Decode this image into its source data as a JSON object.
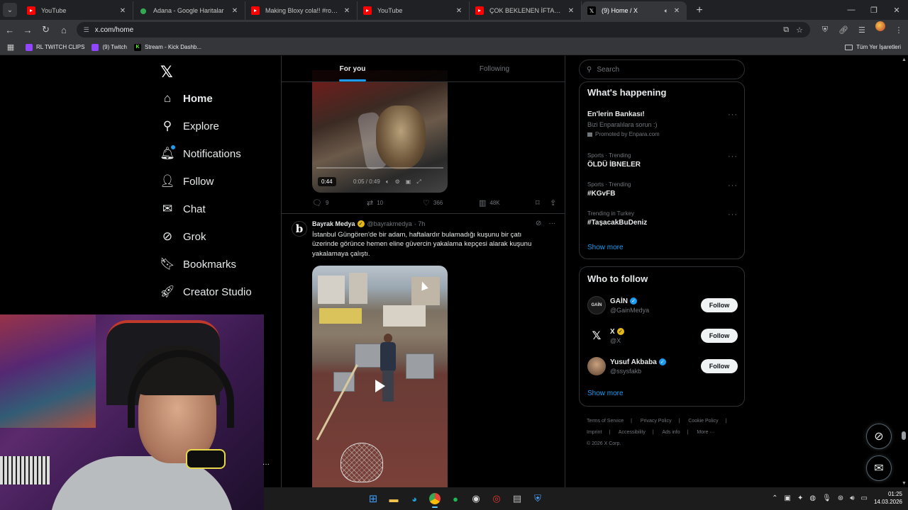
{
  "browser": {
    "tabs": [
      {
        "title": "YouTube",
        "icon": "youtube-icon",
        "active": false
      },
      {
        "title": "Adana - Google Haritalar",
        "icon": "maps-icon",
        "active": false
      },
      {
        "title": "Making Bloxy cola!! #roblox #p",
        "icon": "youtube-icon",
        "active": false
      },
      {
        "title": "YouTube",
        "icon": "youtube-icon",
        "active": false
      },
      {
        "title": "ÇOK BEKLENEN İFTAR! | Alperen",
        "icon": "youtube-icon",
        "active": false
      },
      {
        "title": "(9) Home / X",
        "icon": "x-icon",
        "active": true
      }
    ],
    "new_tab_label": "+",
    "url": "x.com/home",
    "bookmarks": [
      {
        "label": "RL TWITCH CLIPS",
        "icon": "twitch-icon"
      },
      {
        "label": "(9) Twitch",
        "icon": "twitch-icon"
      },
      {
        "label": "Stream - Kick Dashb...",
        "icon": "kick-icon"
      }
    ],
    "all_bookmarks_label": "Tüm Yer İşaretleri"
  },
  "nav": {
    "logo": "𝕏",
    "items": [
      {
        "label": "Home",
        "icon": "home-icon",
        "glyph": "⌂",
        "active": true
      },
      {
        "label": "Explore",
        "icon": "search-icon",
        "glyph": "⚲",
        "active": false
      },
      {
        "label": "Notifications",
        "icon": "bell-icon",
        "glyph": "🔔︎",
        "active": false,
        "badge": true
      },
      {
        "label": "Follow",
        "icon": "person-add-icon",
        "glyph": "👤︎",
        "active": false
      },
      {
        "label": "Chat",
        "icon": "mail-icon",
        "glyph": "✉",
        "active": false
      },
      {
        "label": "Grok",
        "icon": "grok-icon",
        "glyph": "⊘",
        "active": false
      },
      {
        "label": "Bookmarks",
        "icon": "bookmark-icon",
        "glyph": "🔖︎",
        "active": false
      },
      {
        "label": "Creator Studio",
        "icon": "rocket-icon",
        "glyph": "🚀︎",
        "active": false
      }
    ]
  },
  "feed": {
    "tabs": [
      {
        "label": "For you",
        "active": true
      },
      {
        "label": "Following",
        "active": false
      }
    ],
    "prev_post": {
      "video_duration": "0:44",
      "video_ctrls": "0:05 / 0:49",
      "replies": "9",
      "reposts": "10",
      "likes": "366",
      "views": "48K"
    },
    "post": {
      "author": "Bayrak Medya",
      "handle": "@bayrakmedya",
      "time": "· 7h",
      "avatar_letter": "b",
      "text": "İstanbul Güngören'de bir adam, haftalardır bulamadığı kuşunu bir çatı üzerinde görünce hemen eline güvercin yakalama kepçesi alarak kuşunu yakalamaya çalıştı."
    }
  },
  "sidebar": {
    "search_placeholder": "Search",
    "happening": {
      "title": "What's happening",
      "trends": [
        {
          "meta": "",
          "name": "En'lerin Bankası!",
          "sub": "Bizi Enparalılara sorun :)",
          "promo": "Promoted by Enpara.com"
        },
        {
          "meta": "Sports · Trending",
          "name": "ÖLDÜ İBNELER",
          "sub": "",
          "promo": ""
        },
        {
          "meta": "Sports · Trending",
          "name": "#KGvFB",
          "sub": "",
          "promo": ""
        },
        {
          "meta": "Trending in Turkey",
          "name": "#TaşacakBuDeniz",
          "sub": "",
          "promo": ""
        }
      ],
      "show_more": "Show more"
    },
    "who_to_follow": {
      "title": "Who to follow",
      "accounts": [
        {
          "name": "GAİN",
          "handle": "@GainMedya",
          "badge": "blue",
          "avatar": "GAİN",
          "follow": "Follow"
        },
        {
          "name": "X",
          "handle": "@X",
          "badge": "gold",
          "avatar": "𝕏",
          "follow": "Follow"
        },
        {
          "name": "Yusuf Akbaba",
          "handle": "@ssysfakb",
          "badge": "blue",
          "avatar": "",
          "follow": "Follow"
        }
      ],
      "show_more": "Show more"
    },
    "footer": {
      "links": [
        "Terms of Service",
        "|",
        "Privacy Policy",
        "|",
        "Cookie Policy",
        "|",
        "Imprint",
        "|",
        "Accessibility",
        "|",
        "Ads info",
        "|",
        "More ···"
      ],
      "copyright": "© 2026 X Corp."
    }
  },
  "taskbar": {
    "time": "01:25",
    "date": "14.03.2026"
  },
  "colors": {
    "accent": "#1d9bf0",
    "background": "#000000",
    "border": "#2f3336",
    "muted": "#71767b",
    "verified_gold": "#e2b719"
  }
}
